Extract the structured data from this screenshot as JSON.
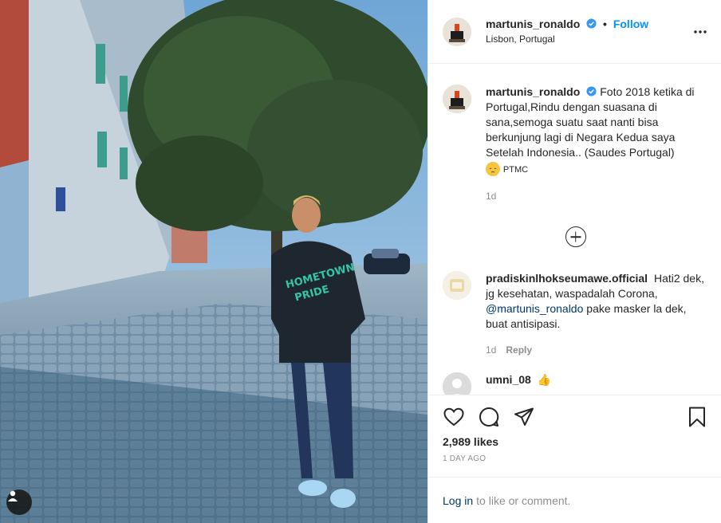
{
  "post": {
    "author": {
      "username": "martunis_ronaldo",
      "verified": true,
      "follow_label": "Follow",
      "separator": "•",
      "location": "Lisbon, Portugal"
    },
    "caption": {
      "username": "martunis_ronaldo",
      "text": "Foto 2018 ketika di Portugal,Rindu dengan suasana di sana,semoga suatu saat nanti bisa berkunjung lagi di Negara Kedua saya Setelah Indonesia.. (Saudes Portugal)",
      "suffix": "PTMC",
      "age": "1d"
    },
    "comments": [
      {
        "username": "pradiskinlhokseumawe.official",
        "text_before": "Hati2 dek, jg kesehatan, waspadalah Corona,",
        "mention": "@martunis_ronaldo",
        "text_after": "pake masker la dek, buat antisipasi.",
        "age": "1d",
        "reply_label": "Reply"
      },
      {
        "username": "umni_08",
        "text": "👍"
      }
    ],
    "likes": "2,989 likes",
    "posted": "1 DAY AGO",
    "login": {
      "link": "Log in",
      "rest": "to like or comment."
    },
    "icons": {
      "more": "more-options-icon",
      "like": "heart-icon",
      "comment": "comment-icon",
      "share": "share-icon",
      "save": "bookmark-icon",
      "load_more": "plus-circle-icon",
      "user_tag": "person-tag-icon",
      "verified": "verified-badge-icon"
    },
    "colors": {
      "accent": "#0095f6",
      "verified": "#3897f0",
      "mention": "#00376b",
      "muted": "#8e8e8e"
    }
  }
}
